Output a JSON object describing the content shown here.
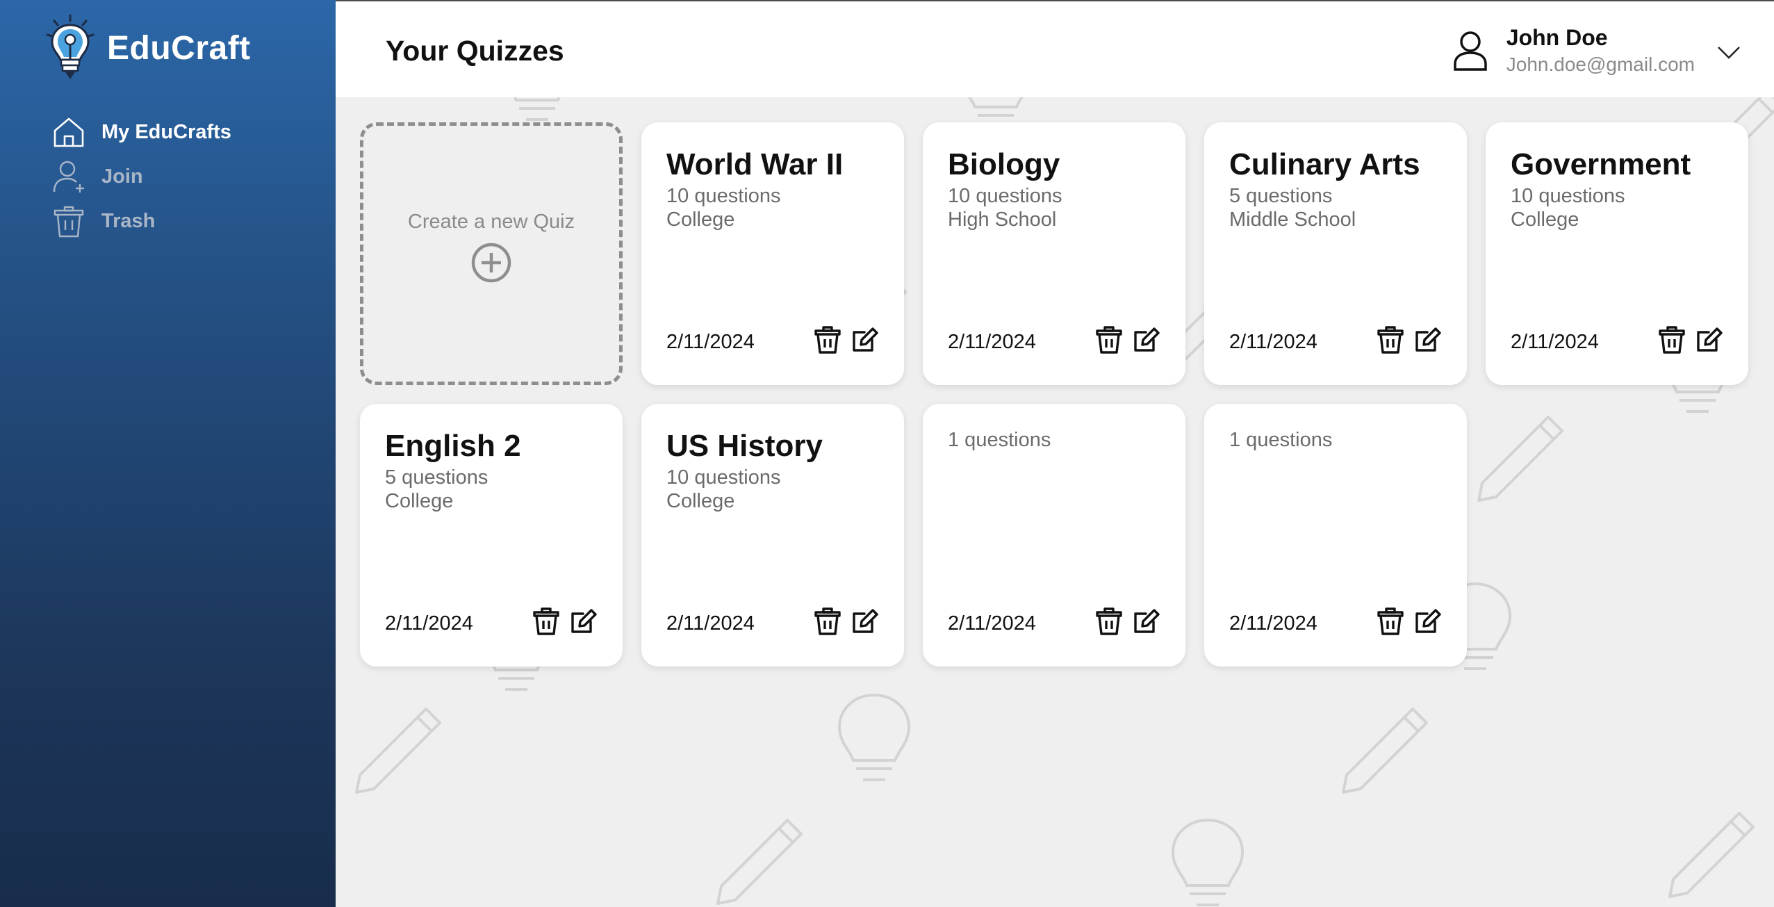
{
  "app": {
    "name": "EduCraft"
  },
  "sidebar": {
    "items": [
      {
        "label": "My EduCrafts",
        "icon": "home-icon",
        "active": true
      },
      {
        "label": "Join",
        "icon": "add-user-icon",
        "active": false
      },
      {
        "label": "Trash",
        "icon": "trash-icon",
        "active": false
      }
    ]
  },
  "header": {
    "title": "Your Quizzes",
    "user": {
      "name": "John Doe",
      "email": "John.doe@gmail.com"
    }
  },
  "create_card": {
    "label": "Create a new Quiz",
    "icon": "plus-circle-icon"
  },
  "quizzes": [
    {
      "title": "World War II",
      "questions": "10 questions",
      "level": "College",
      "date": "2/11/2024"
    },
    {
      "title": "Biology",
      "questions": "10 questions",
      "level": "High School",
      "date": "2/11/2024"
    },
    {
      "title": "Culinary Arts",
      "questions": "5 questions",
      "level": "Middle School",
      "date": "2/11/2024"
    },
    {
      "title": "Government",
      "questions": "10 questions",
      "level": "College",
      "date": "2/11/2024"
    },
    {
      "title": "English 2",
      "questions": "5 questions",
      "level": "College",
      "date": "2/11/2024"
    },
    {
      "title": "US History",
      "questions": "10 questions",
      "level": "College",
      "date": "2/11/2024"
    },
    {
      "title": "",
      "questions": "1 questions",
      "level": "",
      "date": "2/11/2024"
    },
    {
      "title": "",
      "questions": "1 questions",
      "level": "",
      "date": "2/11/2024"
    }
  ],
  "colors": {
    "sidebar_top": "#2c67a8",
    "sidebar_bottom": "#182d4b",
    "page_bg": "#efefef",
    "card_bg": "#ffffff"
  }
}
